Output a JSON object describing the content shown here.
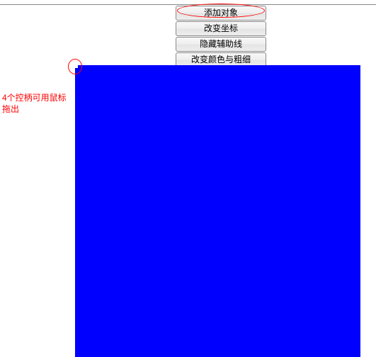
{
  "toolbar": {
    "buttons": [
      {
        "label": "添加对象"
      },
      {
        "label": "改变坐标"
      },
      {
        "label": "隐藏辅助线"
      },
      {
        "label": "改变颜色与粗细"
      }
    ]
  },
  "annotations": {
    "handle_note": "4个控柄可用鼠标拖出"
  },
  "colors": {
    "canvas_fill": "#0000ff",
    "annotation": "#ff0000"
  }
}
